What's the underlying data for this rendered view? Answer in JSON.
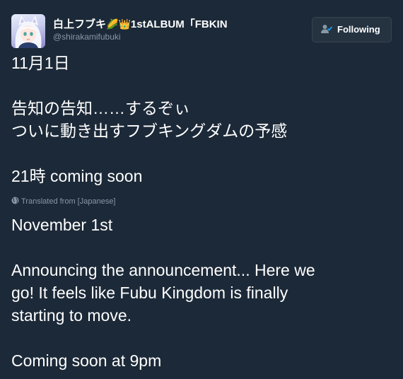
{
  "user": {
    "display_name": "白上フブキ",
    "name_emoji_1": "🌽",
    "name_emoji_2": "👑",
    "name_suffix": "1stALBUM「FBKIN",
    "handle": "@shirakamifubuki",
    "avatar_icon": "avatar-white-fox-girl"
  },
  "follow_button": {
    "label": "Following",
    "icon": "person-check-icon"
  },
  "tweet": {
    "original": {
      "line1": "11月1日",
      "line2": "告知の告知……するぞぃ",
      "line3": "ついに動き出すフブキングダムの予感",
      "line4": "21時 coming soon"
    },
    "translation_label": "Translated from [Japanese]",
    "translated": {
      "line1": "November 1st",
      "line2": "Announcing the announcement... Here we",
      "line3": "go! It feels like Fubu Kingdom is finally",
      "line4": "starting to move.",
      "line5": "Coming soon at 9pm"
    }
  },
  "colors": {
    "background": "#1c2938",
    "text": "#ffffff",
    "secondary_text": "#8899a6",
    "button_bg": "#253341",
    "button_border": "#38444d",
    "accent": "#1da1f2"
  }
}
